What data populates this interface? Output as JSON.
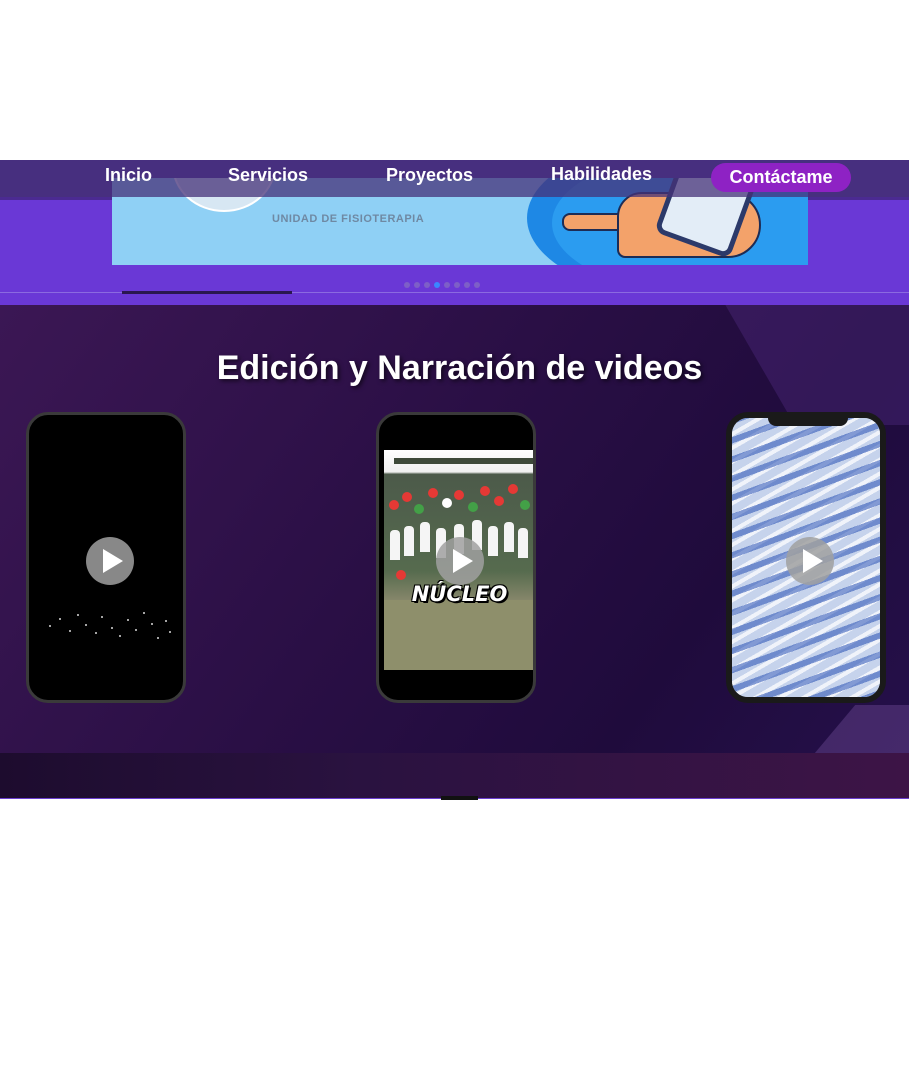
{
  "nav": {
    "items": [
      {
        "label": "Inicio"
      },
      {
        "label": "Servicios"
      },
      {
        "label": "Proyectos"
      },
      {
        "label": "Habilidades"
      }
    ],
    "contact_label": "Contáctame"
  },
  "hero": {
    "slide_caption": "UNIDAD DE FISIOTERAPIA",
    "dots_count": 8,
    "active_dot": 3
  },
  "section": {
    "title": "Edición y Narración de videos"
  },
  "videos": [
    {
      "thumbnail": "dark-sparkles",
      "overlay_text": ""
    },
    {
      "thumbnail": "school-crowd",
      "overlay_text": "NÚCLEO"
    },
    {
      "thumbnail": "blue-motion-blur",
      "overlay_text": ""
    }
  ],
  "colors": {
    "nav_bg": "#46327a",
    "contact_button": "#8e22c4",
    "hero_bg": "#6a38d6",
    "section_bg": "#2a0f45",
    "active_dot": "#3a86ff"
  },
  "icons": {
    "play": "play-icon"
  }
}
